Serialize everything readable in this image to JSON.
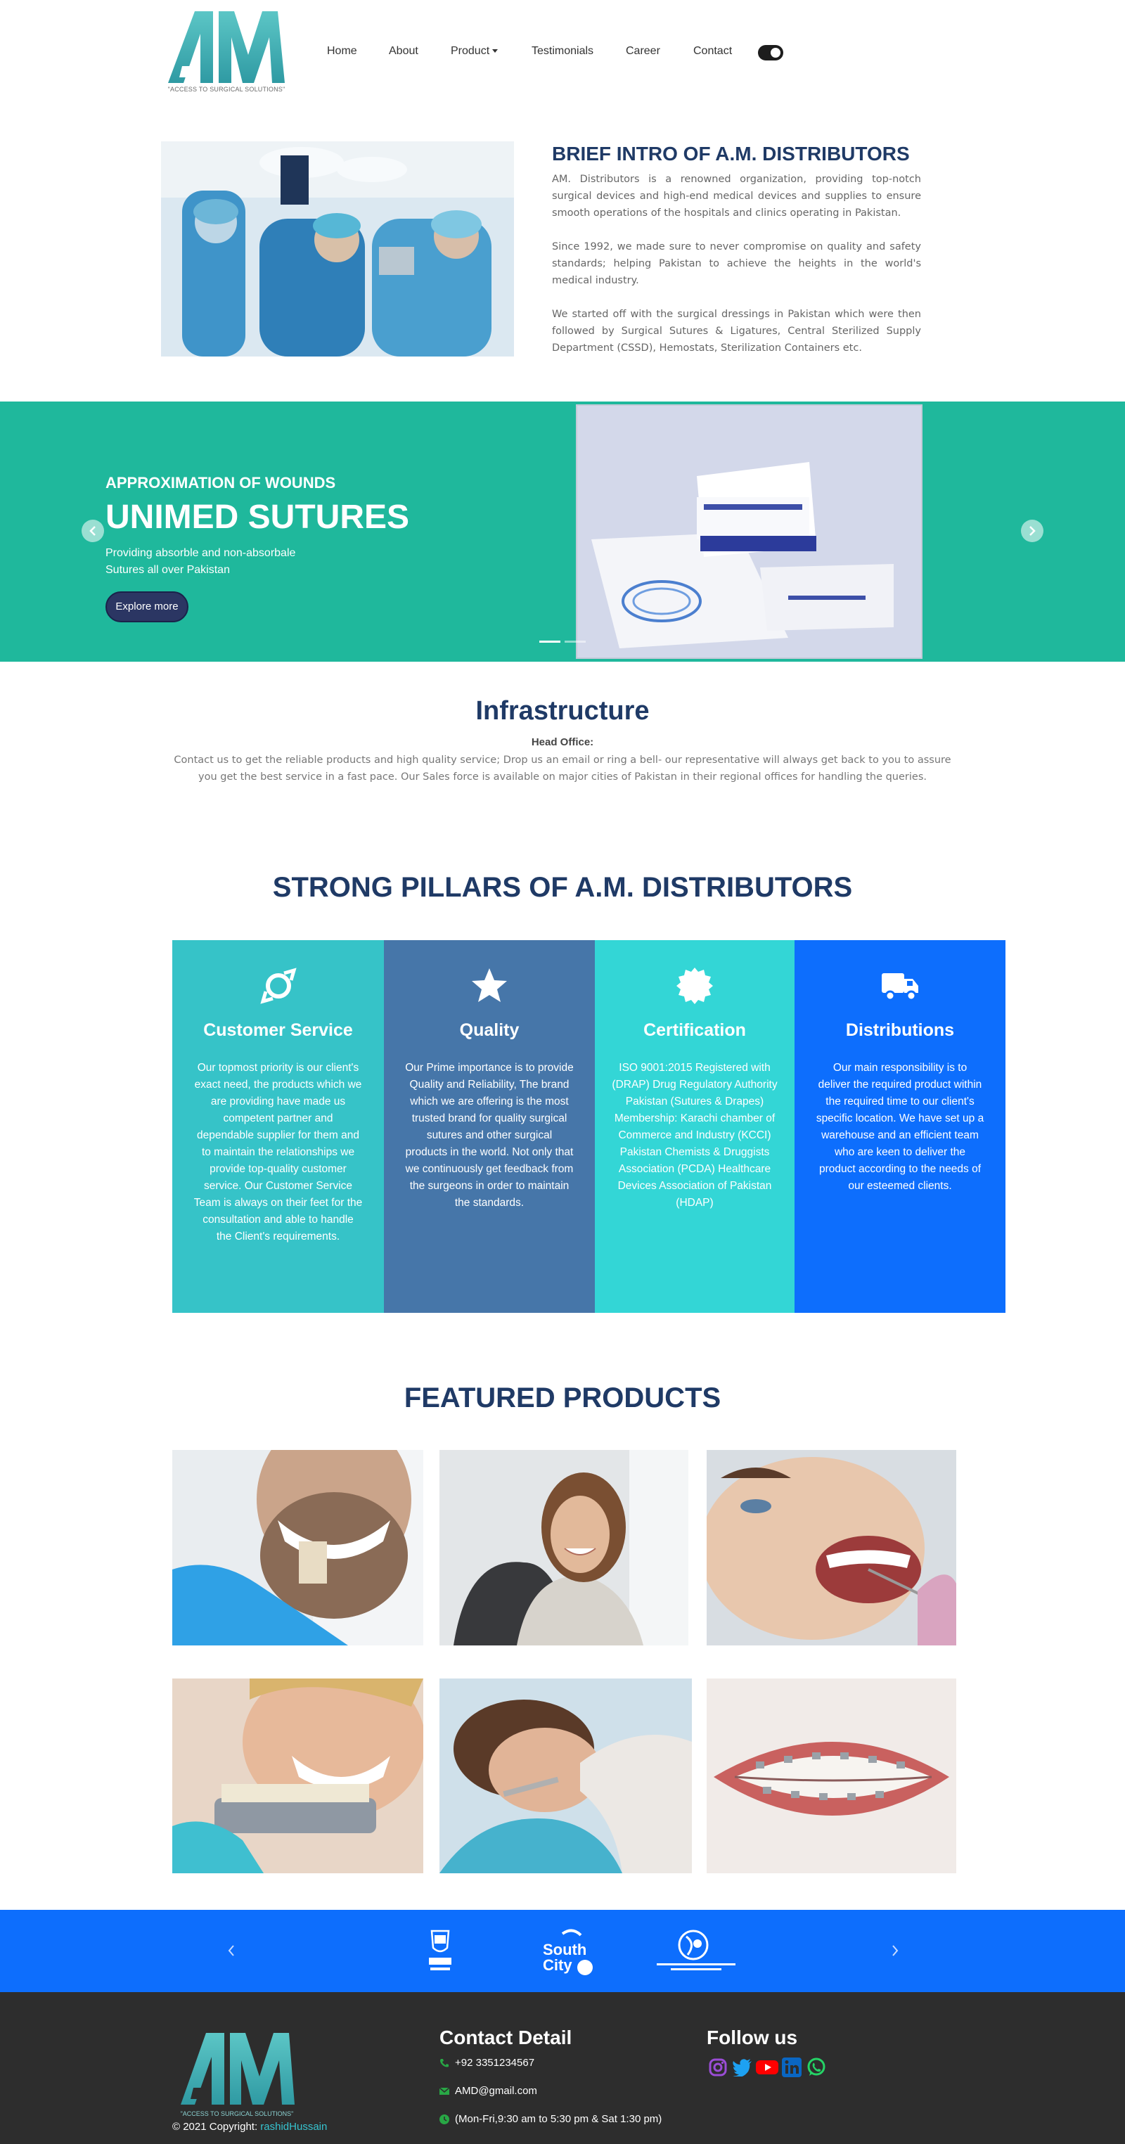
{
  "brand": {
    "logo_text": "AM",
    "tagline": "\"ACCESS TO SURGICAL SOLUTIONS\""
  },
  "nav": {
    "home": "Home",
    "about": "About",
    "product": "Product",
    "testimonials": "Testimonials",
    "career": "Career",
    "contact": "Contact"
  },
  "intro": {
    "title": "BRIEF INTRO OF A.M. DISTRIBUTORS",
    "p1": "AM. Distributors is a renowned organization, providing top-notch surgical devices and high-end medical devices and supplies to ensure smooth operations of the hospitals and clinics operating in Pakistan.",
    "p2": "Since 1992, we made sure to never compromise on quality and safety standards; helping Pakistan to achieve the heights in the world's medical industry.",
    "p3": "We started off with the surgical dressings in Pakistan which were then followed by Surgical Sutures & Ligatures, Central Sterilized Supply Department (CSSD), Hemostats, Sterilization Containers etc."
  },
  "slider": {
    "kicker": "APPROXIMATION OF WOUNDS",
    "title": "UNIMED SUTURES",
    "desc": "Providing absorble and non-absorbale Sutures all over Pakistan",
    "button": "Explore more",
    "bg_color": "#1fb89c"
  },
  "infrastructure": {
    "title": "Infrastructure",
    "head": "Head Office:",
    "text": "Contact us to get the reliable products and high quality service; Drop us an email or ring a bell- our representative will always get back to you to assure you get the best service in a fast pace. Our Sales force is available on major cities of Pakistan in their regional offices for handling the queries."
  },
  "pillars": {
    "title": "STRONG PILLARS OF A.M. DISTRIBUTORS",
    "items": [
      {
        "title": "Customer Service",
        "icon": "ring-icon",
        "color": "#36c3c8",
        "text": "Our topmost priority is our client's exact need, the products which we are providing have made us competent partner and dependable supplier for them and to maintain the relationships we provide top-quality customer service. Our Customer Service Team is always on their feet for the consultation and able to handle the Client's requirements."
      },
      {
        "title": "Quality",
        "icon": "star-icon",
        "color": "#4676a9",
        "text": "Our Prime importance is to provide Quality and Reliability, The brand which we are offering is the most trusted brand for quality surgical sutures and other surgical products in the world. Not only that we continuously get feedback from the surgeons in order to maintain the standards."
      },
      {
        "title": "Certification",
        "icon": "certificate-icon",
        "color": "#33d6d6",
        "text": "ISO 9001:2015 Registered with (DRAP) Drug Regulatory Authority Pakistan (Sutures & Drapes) Membership: Karachi chamber of Commerce and Industry (KCCI) Pakistan Chemists & Druggists Association (PCDA) Healthcare Devices Association of Pakistan (HDAP)"
      },
      {
        "title": "Distributions",
        "icon": "truck-icon",
        "color": "#0d6efd",
        "text": "Our main responsibility is to deliver the required product within the required time to our client's specific location. We have set up a warehouse and an efficient team who are keen to deliver the product according to the needs of our esteemed clients."
      }
    ]
  },
  "featured": {
    "title": "FEATURED PRODUCTS"
  },
  "partners": {
    "logos": [
      "SAIFEE HOSPITAL",
      "South City",
      "SHAHEED MOHTARMA BENAZIR BHUTTO INSTITUTE OF TRAUMA"
    ],
    "bg_color": "#0d6efd"
  },
  "footer": {
    "contact_title": "Contact Detail",
    "phone": "+92 3351234567",
    "email": "AMD@gmail.com",
    "hours": "(Mon-Fri,9:30 am to 5:30 pm & Sat 1:30 pm)",
    "follow_title": "Follow us",
    "copyright_prefix": "© 2021 Copyright: ",
    "copyright_link": "rashidHussain",
    "social": [
      "instagram-icon",
      "twitter-icon",
      "youtube-icon",
      "linkedin-icon",
      "whatsapp-icon"
    ]
  }
}
